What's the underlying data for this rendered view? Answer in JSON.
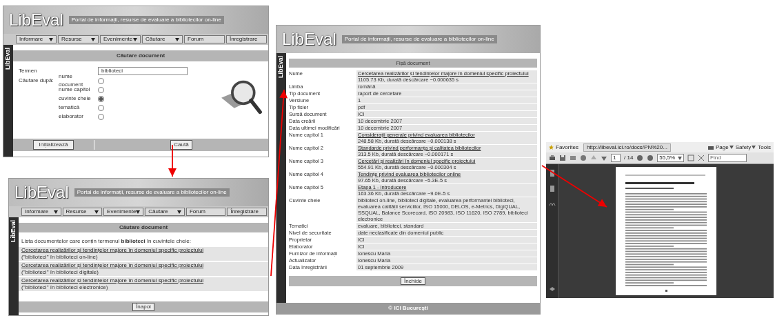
{
  "search_page": {
    "logo": "LibEval",
    "tagline": "Portal de informații, resurse de evaluare a bibliotecilor on-line",
    "side_label": "LibEval",
    "menu": [
      {
        "label": "Informare",
        "dropdown": true
      },
      {
        "label": "Resurse",
        "dropdown": true
      },
      {
        "label": "Evenimente",
        "dropdown": true
      },
      {
        "label": "Căutare",
        "dropdown": true
      },
      {
        "label": "Forum",
        "dropdown": false
      },
      {
        "label": "Înregistrare",
        "dropdown": false
      }
    ],
    "heading": "Căutare document",
    "term_label": "Termen",
    "term_value": "biblioteci",
    "by_label": "Căutare după:",
    "options": [
      {
        "label": "nume document",
        "selected": false
      },
      {
        "label": "nume capitol",
        "selected": false
      },
      {
        "label": "cuvinte cheie",
        "selected": true
      },
      {
        "label": "tematică",
        "selected": false
      },
      {
        "label": "elaborator",
        "selected": false
      }
    ],
    "reset_button": "Inițializează",
    "search_button": "Caută"
  },
  "results_page": {
    "logo": "LibEval",
    "tagline": "Portal de informații, resurse de evaluare a bibliotecilor on-line",
    "side_label": "LibEval",
    "menu": [
      {
        "label": "Informare",
        "dropdown": true
      },
      {
        "label": "Resurse",
        "dropdown": true
      },
      {
        "label": "Evenimente",
        "dropdown": true
      },
      {
        "label": "Căutare",
        "dropdown": true
      },
      {
        "label": "Forum",
        "dropdown": false
      },
      {
        "label": "Înregistrare",
        "dropdown": false
      }
    ],
    "heading": "Căutare document",
    "intro": "Lista documentelor care conțin termenul **biblioteci** în cuvintele cheie:",
    "results": [
      {
        "link": "Cercetarea realizărilor și tendințelor majore în domeniul specific proiectului",
        "note": "(\"biblioteci\" în biblioteci on-line)"
      },
      {
        "link": "Cercetarea realizărilor și tendințelor majore în domeniul specific proiectului",
        "note": "(\"biblioteci\" în biblioteci digitale)"
      },
      {
        "link": "Cercetarea realizărilor și tendințelor majore în domeniul specific proiectului",
        "note": "(\"biblioteci\" în biblioteci electronice)"
      }
    ],
    "back_button": "Înapoi"
  },
  "detail_page": {
    "logo": "LibEval",
    "tagline": "Portal de informații, resurse de evaluare a bibliotecilor on-line",
    "side_label": "LibEval",
    "heading": "Fișă document",
    "fields": [
      {
        "label": "Nume",
        "link": "Cercetarea realizărilor și tendințelor majore în domeniul specific proiectului",
        "value": "1105.73 Kb, durată descărcare ~0.000635 s"
      },
      {
        "label": "Limba",
        "value": "română"
      },
      {
        "label": "Tip document",
        "value": "raport de cercetare"
      },
      {
        "label": "Versiune",
        "value": "1"
      },
      {
        "label": "Tip fișier",
        "value": "pdf"
      },
      {
        "label": "Sursă document",
        "value": "ICI"
      },
      {
        "label": "Data creării",
        "value": "10 decembrie 2007"
      },
      {
        "label": "Data ultimei modificări",
        "value": "10 decembrie 2007"
      },
      {
        "label": "Nume capitol 1",
        "link": "Considerații generale privind evaluarea bibliotecilor",
        "value": "248.58 Kb, durată descărcare ~0.000138 s"
      },
      {
        "label": "Nume capitol 2",
        "link": "Standarde privind performanța și calitatea bibliotecilor",
        "value": "313.5 Kb, durată descărcare ~0.000171 s"
      },
      {
        "label": "Nume capitol 3",
        "link": "Cercetări și realizări în domeniul specific proiectului",
        "value": "554.91 Kb, durată descărcare ~0.000304 s"
      },
      {
        "label": "Nume capitol 4",
        "link": "Tendințe privind evaluarea bibliotecilor online",
        "value": "97.65 Kb, durată descărcare ~5.3E-5 s"
      },
      {
        "label": "Nume capitol 5",
        "link": "Etapa 1 - Introducere",
        "value": "163.36 Kb, durată descărcare ~9.0E-5 s"
      },
      {
        "label": "Cuvinte cheie",
        "value": "biblioteci on-line, biblioteci digitale, evaluarea performanței biblioteci, evaluarea calității serviciilor, ISO 15000, DELOS, e-Metrics, DigiQUAL, SSQUAL, Balance Scorecard, ISO 20983, ISO 11620, ISO 2789, biblioteci electronice"
      },
      {
        "label": "Tematici",
        "value": "evaluare, biblioteci, standard"
      },
      {
        "label": "Nivel de securitate",
        "value": "date neclasificate din domeniul public"
      },
      {
        "label": "Proprietar",
        "value": "ICI"
      },
      {
        "label": "Elaborator",
        "value": "ICI"
      },
      {
        "label": "Furnizor de informații",
        "value": "Ionescu Maria"
      },
      {
        "label": "Actualizator",
        "value": "Ionescu Maria"
      },
      {
        "label": "Data înregistrării",
        "value": "01 septembrie 2009"
      }
    ],
    "close_button": "Închide",
    "footer": "© ICI București"
  },
  "pdf_viewer": {
    "favorites": "Favorites",
    "address": "http://libeval.ici.ro/docs/PN%20...",
    "commands": [
      {
        "label": "Page",
        "dropdown": true
      },
      {
        "label": "Safety",
        "dropdown": true
      },
      {
        "label": "Tools",
        "dropdown": false
      }
    ],
    "page_number": "1",
    "page_count": "/ 14",
    "zoom": "55,5%",
    "find_placeholder": "Find"
  }
}
